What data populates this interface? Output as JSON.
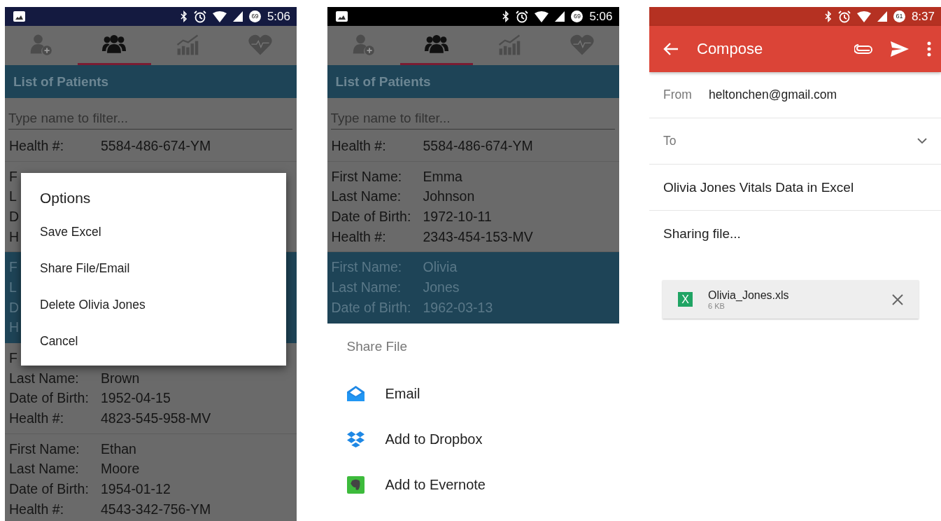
{
  "screens": [
    {
      "kind": "patient-list",
      "status_bar": {
        "image_icon": true,
        "battery": "69",
        "time": "5:06"
      },
      "tabs": [
        {
          "selected": false
        },
        {
          "selected": true
        },
        {
          "selected": false
        },
        {
          "selected": false
        }
      ],
      "title": "List of Patients",
      "filter": {
        "placeholder": "Type name to filter..."
      },
      "patients": [
        {
          "selected": false,
          "fields": [
            {
              "label": "Health #:",
              "value": "5584-486-674-YM"
            }
          ]
        },
        {
          "selected": false,
          "fields": [
            {
              "label": "F"
            },
            {
              "label": "L"
            },
            {
              "label": "D"
            },
            {
              "label": "H"
            }
          ]
        },
        {
          "selected": true,
          "fields": [
            {
              "label": "F"
            },
            {
              "label": "L"
            },
            {
              "label": "D"
            },
            {
              "label": "H"
            }
          ]
        },
        {
          "selected": false,
          "fields": [
            {
              "label": "F"
            },
            {
              "label": "Last Name:",
              "value": "Brown"
            },
            {
              "label": "Date of Birth:",
              "value": "1952-04-15"
            },
            {
              "label": "Health #:",
              "value": "4823-545-958-MV"
            }
          ]
        },
        {
          "selected": false,
          "fields": [
            {
              "label": "First Name:",
              "value": "Ethan"
            },
            {
              "label": "Last Name:",
              "value": "Moore"
            },
            {
              "label": "Date of Birth:",
              "value": "1954-01-12"
            },
            {
              "label": "Health #:",
              "value": "4543-342-756-YM"
            }
          ]
        }
      ],
      "overlay": {
        "kind": "dialog",
        "title": "Options",
        "items": [
          "Save Excel",
          "Share File/Email",
          "Delete Olivia Jones",
          "Cancel"
        ]
      }
    },
    {
      "kind": "patient-list",
      "status_bar": {
        "image_icon": true,
        "battery": "69",
        "time": "5:06"
      },
      "tabs": [
        {
          "selected": false
        },
        {
          "selected": true
        },
        {
          "selected": false
        },
        {
          "selected": false
        }
      ],
      "title": "List of Patients",
      "filter": {
        "placeholder": "Type name to filter..."
      },
      "patients": [
        {
          "selected": false,
          "fields": [
            {
              "label": "Health #:",
              "value": "5584-486-674-YM"
            }
          ]
        },
        {
          "selected": false,
          "fields": [
            {
              "label": "First Name:",
              "value": "Emma"
            },
            {
              "label": "Last Name:",
              "value": "Johnson"
            },
            {
              "label": "Date of Birth:",
              "value": "1972-10-11"
            },
            {
              "label": "Health #:",
              "value": "2343-454-153-MV"
            }
          ]
        },
        {
          "selected": true,
          "fields": [
            {
              "label": "First Name:",
              "value": "Olivia"
            },
            {
              "label": "Last Name:",
              "value": "Jones"
            },
            {
              "label": "Date of Birth:",
              "value": "1962-03-13"
            }
          ]
        }
      ],
      "overlay": {
        "kind": "sheet",
        "title": "Share File",
        "items": [
          "Email",
          "Add to Dropbox",
          "Add to Evernote"
        ]
      }
    },
    {
      "kind": "compose",
      "status_bar": {
        "image_icon": false,
        "battery": "61",
        "time": "8:37"
      },
      "app_bar": {
        "title": "Compose"
      },
      "from": {
        "label": "From",
        "value": "heltonchen@gmail.com"
      },
      "to": {
        "label": "To"
      },
      "subject": "Olivia Jones Vitals Data in Excel",
      "body": "Sharing file...",
      "attachment": {
        "icon_text": "X",
        "name": "Olivia_Jones.xls",
        "size": "6 KB"
      }
    }
  ]
}
